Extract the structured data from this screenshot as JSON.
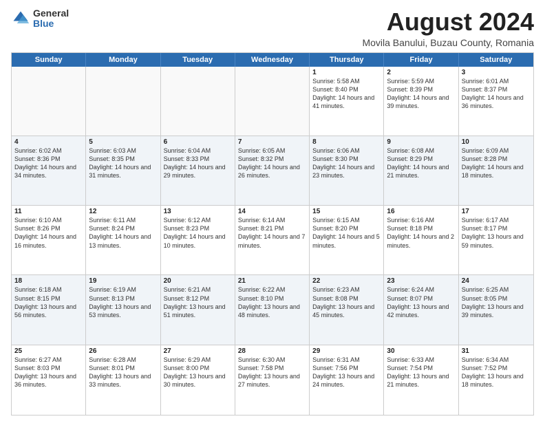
{
  "logo": {
    "general": "General",
    "blue": "Blue"
  },
  "title": "August 2024",
  "subtitle": "Movila Banului, Buzau County, Romania",
  "headers": [
    "Sunday",
    "Monday",
    "Tuesday",
    "Wednesday",
    "Thursday",
    "Friday",
    "Saturday"
  ],
  "weeks": [
    [
      {
        "day": "",
        "info": ""
      },
      {
        "day": "",
        "info": ""
      },
      {
        "day": "",
        "info": ""
      },
      {
        "day": "",
        "info": ""
      },
      {
        "day": "1",
        "info": "Sunrise: 5:58 AM\nSunset: 8:40 PM\nDaylight: 14 hours\nand 41 minutes."
      },
      {
        "day": "2",
        "info": "Sunrise: 5:59 AM\nSunset: 8:39 PM\nDaylight: 14 hours\nand 39 minutes."
      },
      {
        "day": "3",
        "info": "Sunrise: 6:01 AM\nSunset: 8:37 PM\nDaylight: 14 hours\nand 36 minutes."
      }
    ],
    [
      {
        "day": "4",
        "info": "Sunrise: 6:02 AM\nSunset: 8:36 PM\nDaylight: 14 hours\nand 34 minutes."
      },
      {
        "day": "5",
        "info": "Sunrise: 6:03 AM\nSunset: 8:35 PM\nDaylight: 14 hours\nand 31 minutes."
      },
      {
        "day": "6",
        "info": "Sunrise: 6:04 AM\nSunset: 8:33 PM\nDaylight: 14 hours\nand 29 minutes."
      },
      {
        "day": "7",
        "info": "Sunrise: 6:05 AM\nSunset: 8:32 PM\nDaylight: 14 hours\nand 26 minutes."
      },
      {
        "day": "8",
        "info": "Sunrise: 6:06 AM\nSunset: 8:30 PM\nDaylight: 14 hours\nand 23 minutes."
      },
      {
        "day": "9",
        "info": "Sunrise: 6:08 AM\nSunset: 8:29 PM\nDaylight: 14 hours\nand 21 minutes."
      },
      {
        "day": "10",
        "info": "Sunrise: 6:09 AM\nSunset: 8:28 PM\nDaylight: 14 hours\nand 18 minutes."
      }
    ],
    [
      {
        "day": "11",
        "info": "Sunrise: 6:10 AM\nSunset: 8:26 PM\nDaylight: 14 hours\nand 16 minutes."
      },
      {
        "day": "12",
        "info": "Sunrise: 6:11 AM\nSunset: 8:24 PM\nDaylight: 14 hours\nand 13 minutes."
      },
      {
        "day": "13",
        "info": "Sunrise: 6:12 AM\nSunset: 8:23 PM\nDaylight: 14 hours\nand 10 minutes."
      },
      {
        "day": "14",
        "info": "Sunrise: 6:14 AM\nSunset: 8:21 PM\nDaylight: 14 hours\nand 7 minutes."
      },
      {
        "day": "15",
        "info": "Sunrise: 6:15 AM\nSunset: 8:20 PM\nDaylight: 14 hours\nand 5 minutes."
      },
      {
        "day": "16",
        "info": "Sunrise: 6:16 AM\nSunset: 8:18 PM\nDaylight: 14 hours\nand 2 minutes."
      },
      {
        "day": "17",
        "info": "Sunrise: 6:17 AM\nSunset: 8:17 PM\nDaylight: 13 hours\nand 59 minutes."
      }
    ],
    [
      {
        "day": "18",
        "info": "Sunrise: 6:18 AM\nSunset: 8:15 PM\nDaylight: 13 hours\nand 56 minutes."
      },
      {
        "day": "19",
        "info": "Sunrise: 6:19 AM\nSunset: 8:13 PM\nDaylight: 13 hours\nand 53 minutes."
      },
      {
        "day": "20",
        "info": "Sunrise: 6:21 AM\nSunset: 8:12 PM\nDaylight: 13 hours\nand 51 minutes."
      },
      {
        "day": "21",
        "info": "Sunrise: 6:22 AM\nSunset: 8:10 PM\nDaylight: 13 hours\nand 48 minutes."
      },
      {
        "day": "22",
        "info": "Sunrise: 6:23 AM\nSunset: 8:08 PM\nDaylight: 13 hours\nand 45 minutes."
      },
      {
        "day": "23",
        "info": "Sunrise: 6:24 AM\nSunset: 8:07 PM\nDaylight: 13 hours\nand 42 minutes."
      },
      {
        "day": "24",
        "info": "Sunrise: 6:25 AM\nSunset: 8:05 PM\nDaylight: 13 hours\nand 39 minutes."
      }
    ],
    [
      {
        "day": "25",
        "info": "Sunrise: 6:27 AM\nSunset: 8:03 PM\nDaylight: 13 hours\nand 36 minutes."
      },
      {
        "day": "26",
        "info": "Sunrise: 6:28 AM\nSunset: 8:01 PM\nDaylight: 13 hours\nand 33 minutes."
      },
      {
        "day": "27",
        "info": "Sunrise: 6:29 AM\nSunset: 8:00 PM\nDaylight: 13 hours\nand 30 minutes."
      },
      {
        "day": "28",
        "info": "Sunrise: 6:30 AM\nSunset: 7:58 PM\nDaylight: 13 hours\nand 27 minutes."
      },
      {
        "day": "29",
        "info": "Sunrise: 6:31 AM\nSunset: 7:56 PM\nDaylight: 13 hours\nand 24 minutes."
      },
      {
        "day": "30",
        "info": "Sunrise: 6:33 AM\nSunset: 7:54 PM\nDaylight: 13 hours\nand 21 minutes."
      },
      {
        "day": "31",
        "info": "Sunrise: 6:34 AM\nSunset: 7:52 PM\nDaylight: 13 hours\nand 18 minutes."
      }
    ]
  ]
}
